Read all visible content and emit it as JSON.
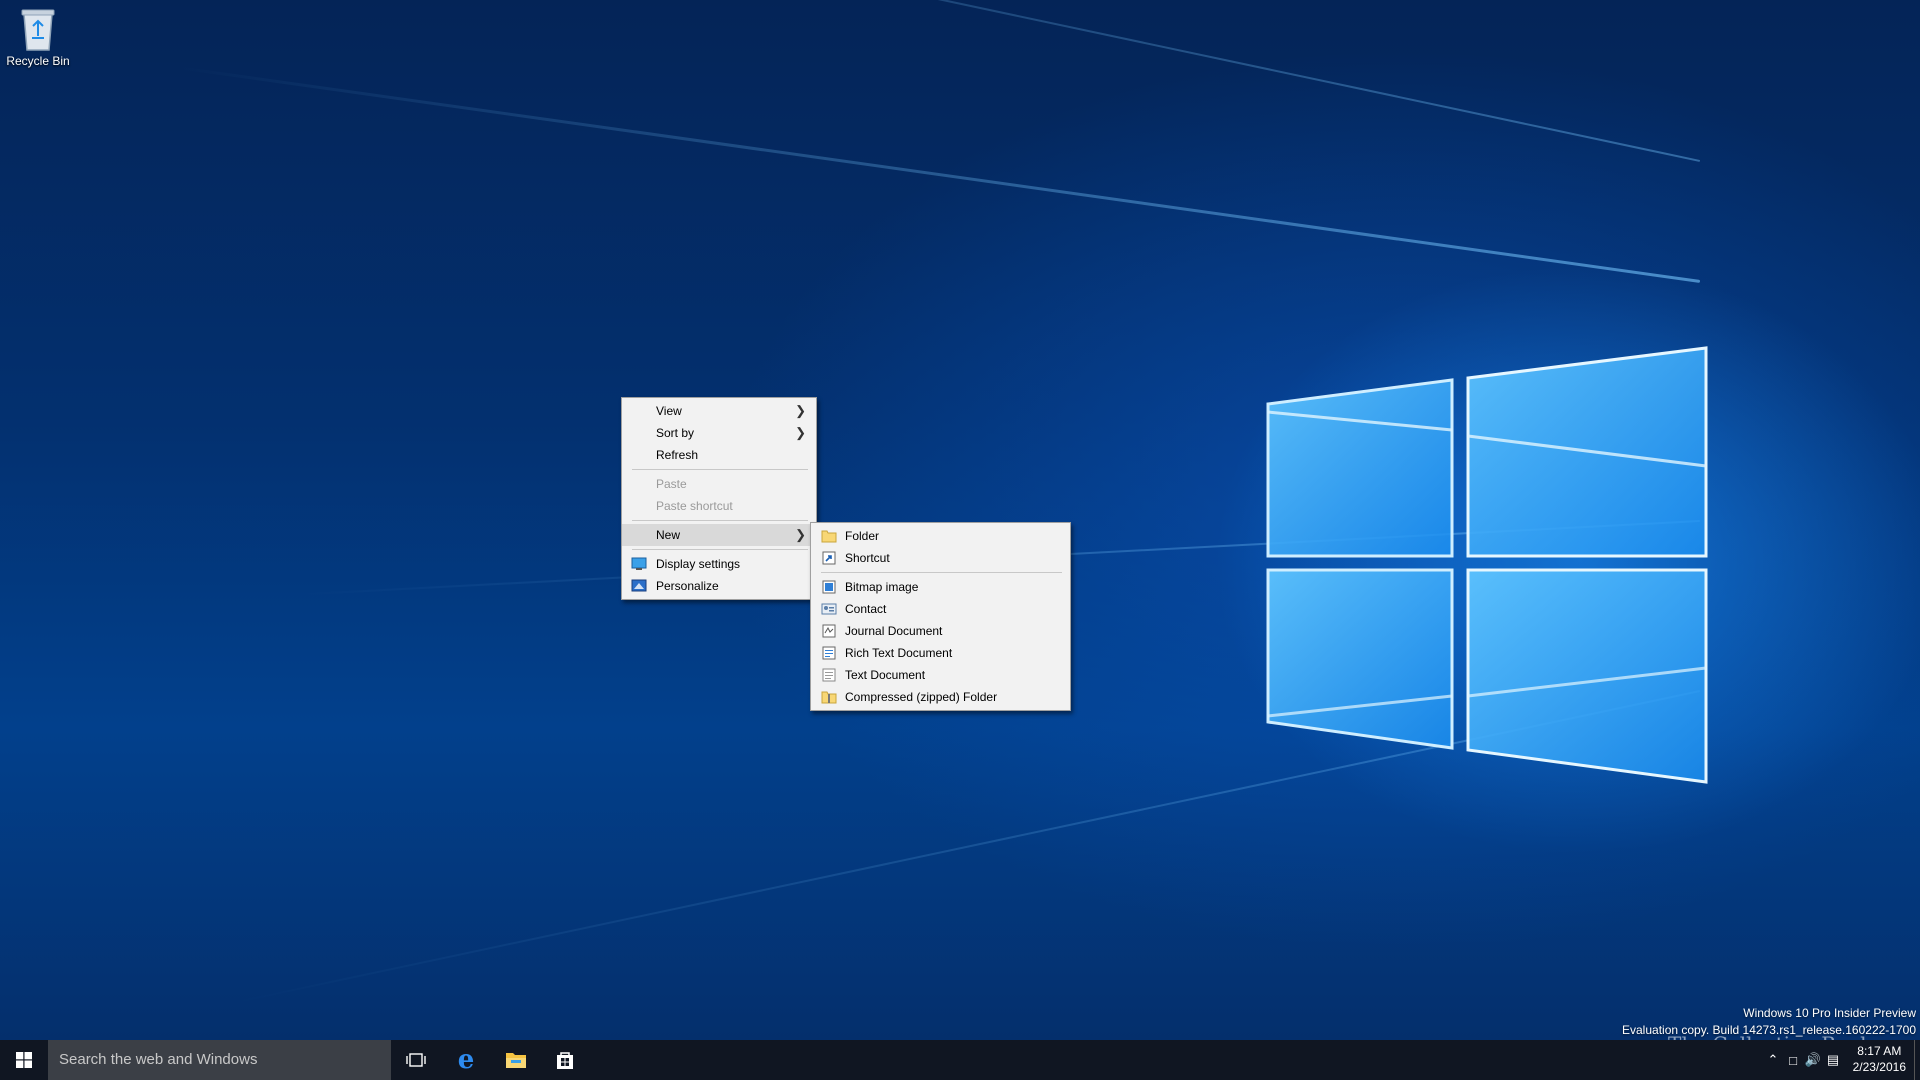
{
  "desktop": {
    "icons": [
      {
        "label": "Recycle Bin",
        "icon": "recycle-bin-icon"
      }
    ],
    "watermark": {
      "line1": "Windows 10 Pro Insider Preview",
      "line2": "Evaluation copy. Build 14273.rs1_release.160222-1700"
    },
    "site_mark": "The Collection Book"
  },
  "context_menu": {
    "view": "View",
    "sort_by": "Sort by",
    "refresh": "Refresh",
    "paste": "Paste",
    "paste_shortcut": "Paste shortcut",
    "new": "New",
    "display_settings": "Display settings",
    "personalize": "Personalize"
  },
  "new_submenu": {
    "folder": "Folder",
    "shortcut": "Shortcut",
    "bitmap_image": "Bitmap image",
    "contact": "Contact",
    "journal_document": "Journal Document",
    "rich_text_document": "Rich Text Document",
    "text_document": "Text Document",
    "compressed_folder": "Compressed (zipped) Folder"
  },
  "taskbar": {
    "search_placeholder": "Search the web and Windows",
    "pinned": [
      "task-view-icon",
      "edge-icon",
      "file-explorer-icon",
      "store-icon"
    ],
    "tray": {
      "time": "8:17 AM",
      "date": "2/23/2016"
    }
  },
  "colors": {
    "taskbar": "#101622",
    "search_box": "#3b3f46",
    "menu_background": "#f2f2f2",
    "menu_highlight": "#d9d9d9",
    "accent": "#0078d7"
  }
}
